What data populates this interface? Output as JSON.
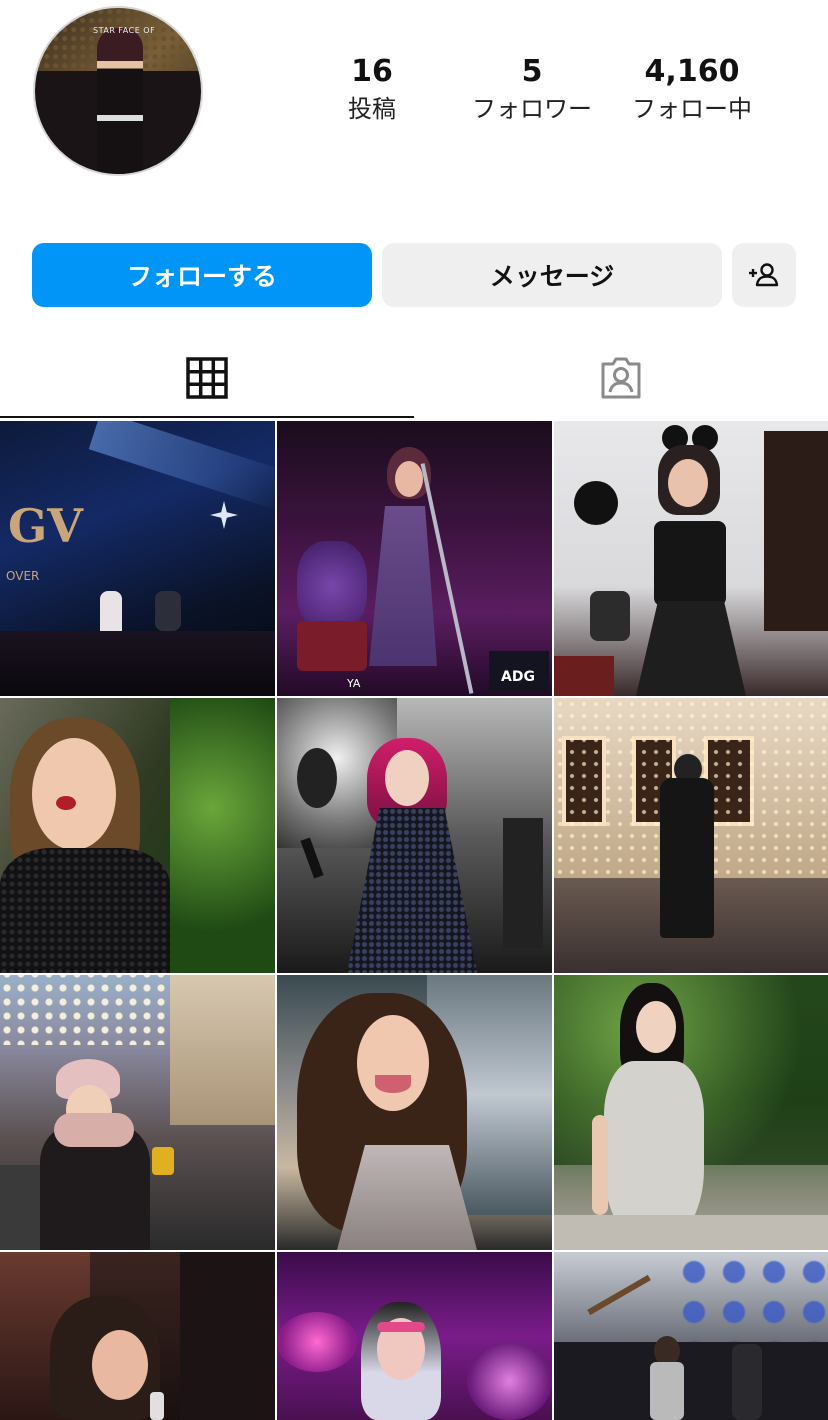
{
  "profile": {
    "avatar_text": "STAR FACE OF",
    "stats": [
      {
        "value": "16",
        "label": "投稿"
      },
      {
        "value": "5",
        "label": "フォロワー"
      },
      {
        "value": "4,160",
        "label": "フォロー中"
      }
    ]
  },
  "actions": {
    "follow_label": "フォローする",
    "message_label": "メッセージ",
    "add_user_icon": "add-user-icon"
  },
  "tabs": {
    "grid_icon": "grid-icon",
    "tagged_icon": "tagged-person-icon",
    "active": "grid"
  },
  "photos": {
    "p1_text": "GV",
    "p1_subtext": "OVER",
    "p2_text": "ADG",
    "p2_drum_text": "YA"
  },
  "colors": {
    "follow_button": "#0095f6",
    "secondary_button": "#efefef",
    "text": "#111111"
  }
}
